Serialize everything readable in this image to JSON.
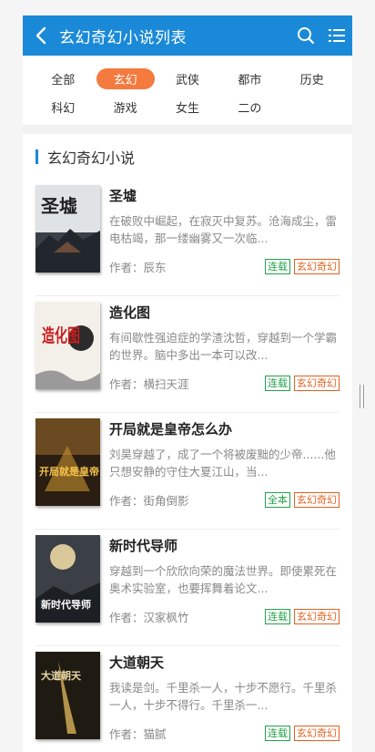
{
  "header": {
    "title": "玄幻奇幻小说列表"
  },
  "categories": [
    {
      "label": "全部",
      "active": false
    },
    {
      "label": "玄幻",
      "active": true
    },
    {
      "label": "武侠",
      "active": false
    },
    {
      "label": "都市",
      "active": false
    },
    {
      "label": "历史",
      "active": false
    },
    {
      "label": "科幻",
      "active": false
    },
    {
      "label": "游戏",
      "active": false
    },
    {
      "label": "女生",
      "active": false
    },
    {
      "label": "二の",
      "active": false
    }
  ],
  "section": {
    "title": "玄幻奇幻小说"
  },
  "author_prefix": "作者：",
  "books": [
    {
      "title": "圣墟",
      "desc": "在破败中崛起，在寂灭中复苏。沧海成尘，雷电枯竭，那一缕幽雾又一次临...",
      "author": "辰东",
      "status": "连载",
      "genre": "玄幻奇幻",
      "cover_text": "圣墟"
    },
    {
      "title": "造化图",
      "desc": "有间歇性强迫症的学渣沈哲，穿越到一个学霸的世界。脑中多出一本可以改...",
      "author": "横扫天涯",
      "status": "连载",
      "genre": "玄幻奇幻",
      "cover_text": "造化图"
    },
    {
      "title": "开局就是皇帝怎么办",
      "desc": "刘昊穿越了，成了一个将被废黜的少帝......他只想安静的守住大夏江山，当...",
      "author": "街角倒影",
      "status": "全本",
      "genre": "玄幻奇幻",
      "cover_text": "开局就是皇帝"
    },
    {
      "title": "新时代导师",
      "desc": "穿越到一个欣欣向荣的魔法世界。即使累死在奥术实验室，也要挥舞着论文...",
      "author": "汉家枫竹",
      "status": "连载",
      "genre": "玄幻奇幻",
      "cover_text": "新时代导师"
    },
    {
      "title": "大道朝天",
      "desc": "我读是剑。千里杀一人，十步不愿行。千里杀一人，十步不得行。千里杀一...",
      "author": "猫腻",
      "status": "连载",
      "genre": "玄幻奇幻",
      "cover_text": "大道朝天"
    }
  ],
  "colors": {
    "header": "#1a8ad8",
    "accent": "#f47a3e",
    "status_green": "#22a24a",
    "genre_orange": "#e2611f"
  }
}
